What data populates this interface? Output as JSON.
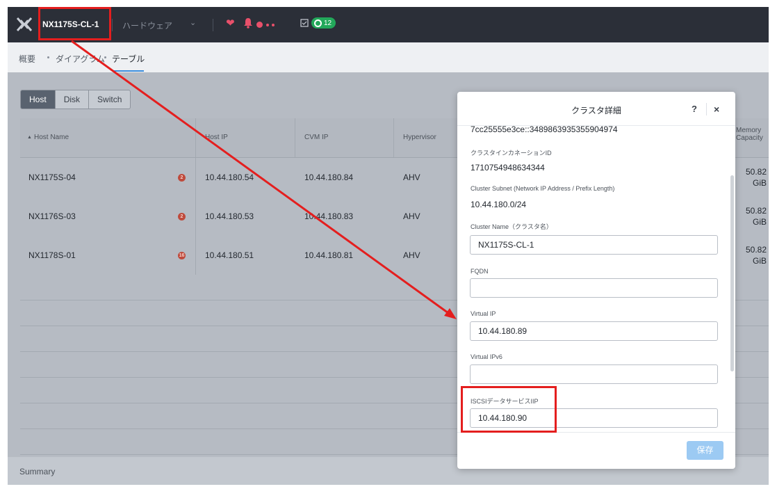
{
  "topbar": {
    "cluster_name": "NX1175S-CL-1",
    "hardware_menu": "ハードウェア",
    "task_count": "12",
    "colors": {
      "bar": "#2b2f38",
      "alert": "#e8506a",
      "task_badge": "#22a85a"
    }
  },
  "subnav": {
    "items": [
      "概要",
      "ダイアグラム",
      "テーブル"
    ],
    "active": "テーブル"
  },
  "tabs": [
    "Host",
    "Disk",
    "Switch"
  ],
  "active_tab": "Host",
  "table": {
    "columns": {
      "host_name": "Host Name",
      "host_ip": "Host IP",
      "cvm_ip": "CVM IP",
      "hypervisor": "Hypervisor",
      "memory_1": "Memory",
      "memory_2": "Capacity"
    },
    "rows": [
      {
        "host_name": "NX1175S-04",
        "alerts": "2",
        "host_ip": "10.44.180.54",
        "cvm_ip": "10.44.180.84",
        "hypervisor": "AHV",
        "memory": "50.82",
        "memory_unit": "GiB"
      },
      {
        "host_name": "NX1176S-03",
        "alerts": "2",
        "host_ip": "10.44.180.53",
        "cvm_ip": "10.44.180.83",
        "hypervisor": "AHV",
        "memory": "50.82",
        "memory_unit": "GiB"
      },
      {
        "host_name": "NX1178S-01",
        "alerts": "16",
        "host_ip": "10.44.180.51",
        "cvm_ip": "10.44.180.81",
        "hypervisor": "AHV",
        "memory": "50.82",
        "memory_unit": "GiB"
      }
    ]
  },
  "summary": "Summary",
  "modal": {
    "title": "クラスタ詳細",
    "help": "?",
    "close": "×",
    "cluster_uuid": "7cc25555e3ce::3489863935355904974",
    "incarnation_label": "クラスタインカネーションID",
    "incarnation_value": "1710754948634344",
    "subnet_label": "Cluster Subnet (Network IP Address / Prefix Length)",
    "subnet_value": "10.44.180.0/24",
    "name_label": "Cluster Name（クラスタ名）",
    "name_value": "NX1175S-CL-1",
    "fqdn_label": "FQDN",
    "fqdn_value": "",
    "vip_label": "Virtual IP",
    "vip_value": "10.44.180.89",
    "vipv6_label": "Virtual IPv6",
    "vipv6_value": "",
    "iscsi_label": "ISCSIデータサービスIIP",
    "iscsi_value": "10.44.180.90",
    "save": "保存"
  }
}
